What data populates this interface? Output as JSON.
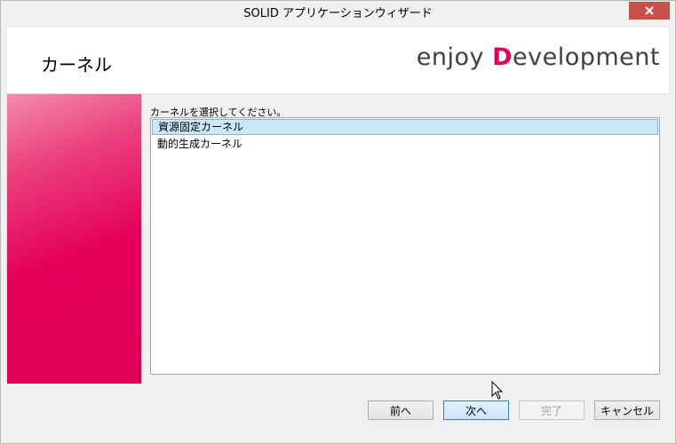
{
  "window": {
    "title": "SOLID アプリケーションウィザード"
  },
  "header": {
    "page_title": "カーネル",
    "brand_prefix": "enjoy ",
    "brand_accent": "D",
    "brand_suffix": "evelopment"
  },
  "colors": {
    "brand_accent": "#e0005c",
    "banner": "#e5005a",
    "selection": "#cbe8f6"
  },
  "content": {
    "prompt": "カーネルを選択してください。",
    "kernels": [
      {
        "label": "資源固定カーネル",
        "selected": true
      },
      {
        "label": "動的生成カーネル",
        "selected": false
      }
    ]
  },
  "footer": {
    "back_label": "前へ",
    "next_label": "次へ",
    "finish_label": "完了",
    "cancel_label": "キャンセル"
  }
}
